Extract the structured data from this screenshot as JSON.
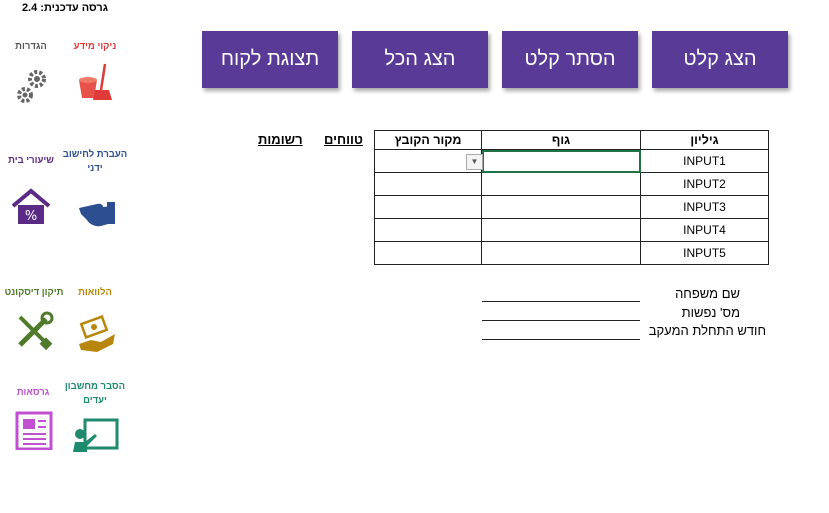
{
  "version_label": "גרסה עדכנית: 2.4",
  "nav": [
    {
      "label": "ניקוי מידע",
      "icon": "cleaning-bucket-icon",
      "color": "#e03a3a"
    },
    {
      "label": "הגדרות",
      "icon": "gears-icon",
      "color": "#555555"
    },
    {
      "label": "העברת לחישוב ידני",
      "icon": "hand-pointing-icon",
      "color": "#2e4f8f"
    },
    {
      "label": "שיעורי בית",
      "icon": "house-percent-icon",
      "color": "#5b2a86"
    },
    {
      "label": "הלוואות",
      "icon": "money-hand-icon",
      "color": "#b8860b"
    },
    {
      "label": "תיקון דיסקונט",
      "icon": "wrench-screwdriver-icon",
      "color": "#4f7a2a"
    },
    {
      "label": "הסבר מחשבון יעדים",
      "icon": "presentation-board-icon",
      "color": "#1e8a6e"
    },
    {
      "label": "גרסאות",
      "icon": "newspaper-icon",
      "color": "#c050d0"
    }
  ],
  "buttons": {
    "show_input": "הצג קלט",
    "hide_input": "הסתר קלט",
    "show_all": "הצג הכל",
    "client_view": "תצוגת לקוח"
  },
  "table": {
    "headers": [
      "גיליון",
      "גוף",
      "מקור הקובץ"
    ],
    "rows": [
      "INPUT1",
      "INPUT2",
      "INPUT3",
      "INPUT4",
      "INPUT5"
    ]
  },
  "side_headers": {
    "ranges": "טווחים",
    "lists": "רשומות"
  },
  "form": {
    "last_name": "שם משפחה",
    "persons": "מס' נפשות",
    "start_month": "חודש התחלת המעקב"
  },
  "accent": "#5a3a97"
}
